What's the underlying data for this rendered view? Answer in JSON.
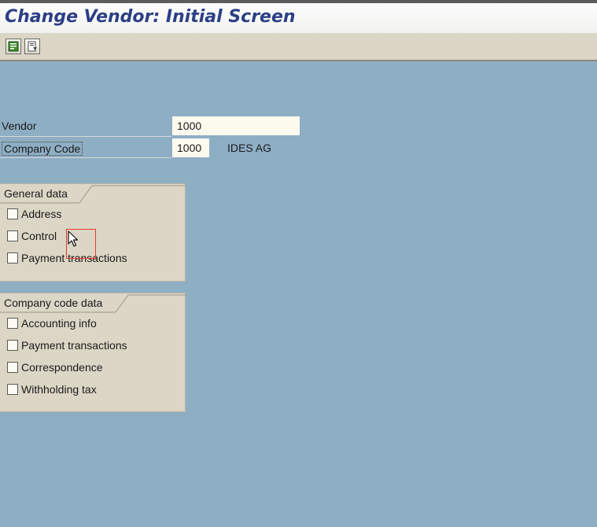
{
  "window": {
    "title": "Change Vendor: Initial Screen"
  },
  "toolbar": {
    "buttons": [
      {
        "icon": "green-document-icon",
        "color": "#3c8a2e"
      },
      {
        "icon": "document-arrow-icon",
        "color": "#4a4a4a"
      }
    ]
  },
  "fields": {
    "vendor": {
      "label": "Vendor",
      "value": "1000"
    },
    "company_code": {
      "label": "Company Code",
      "value": "1000",
      "description": "IDES AG"
    }
  },
  "general_data": {
    "title": "General data",
    "items": [
      {
        "label": "Address",
        "checked": false
      },
      {
        "label": "Control",
        "checked": false
      },
      {
        "label": "Payment transactions",
        "checked": false
      }
    ]
  },
  "company_code_data": {
    "title": "Company code data",
    "items": [
      {
        "label": "Accounting info",
        "checked": false
      },
      {
        "label": "Payment transactions",
        "checked": false
      },
      {
        "label": "Correspondence",
        "checked": false
      },
      {
        "label": "Withholding tax",
        "checked": false
      }
    ]
  },
  "colors": {
    "background": "#8eaec4",
    "title": "#2b3f86",
    "panel": "#dcd6c6",
    "input": "#fcfaee",
    "cursor_highlight": "#e8392a"
  }
}
